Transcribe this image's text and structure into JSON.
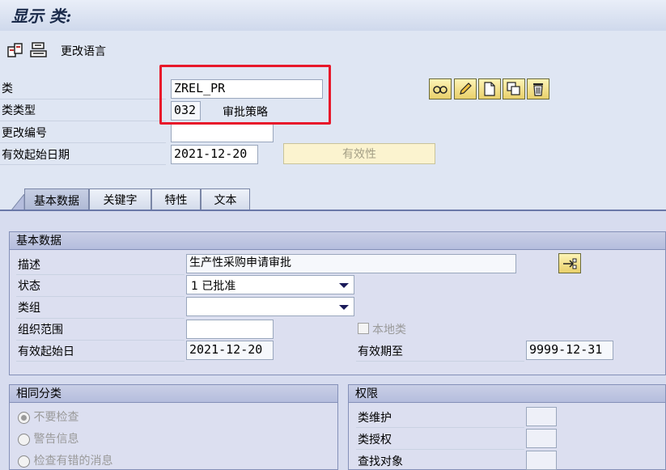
{
  "window": {
    "title": "显示 类:"
  },
  "toolbar": {
    "change_language_label": "更改语言"
  },
  "header": {
    "class_label": "类",
    "class_value": "ZREL_PR",
    "class_type_label": "类类型",
    "class_type_value": "032",
    "class_type_text": "审批策略",
    "change_number_label": "更改编号",
    "change_number_value": "",
    "valid_from_label": "有效起始日期",
    "valid_from_value": "2021-12-20",
    "validity_button": "有效性"
  },
  "tabs": [
    {
      "label": "基本数据",
      "active": true
    },
    {
      "label": "关键字",
      "active": false
    },
    {
      "label": "特性",
      "active": false
    },
    {
      "label": "文本",
      "active": false
    }
  ],
  "basic_data": {
    "title": "基本数据",
    "description_label": "描述",
    "description_value": "生产性采购申请审批",
    "status_label": "状态",
    "status_value": "1 已批准",
    "class_group_label": "类组",
    "class_group_value": "",
    "org_area_label": "组织范围",
    "org_area_value": "",
    "local_class_label": "本地类",
    "valid_from_label": "有效起始日",
    "valid_from_value": "2021-12-20",
    "valid_to_label": "有效期至",
    "valid_to_value": "9999-12-31"
  },
  "same_classification": {
    "title": "相同分类",
    "options": [
      "不要检查",
      "警告信息",
      "检查有错的消息"
    ]
  },
  "authorization": {
    "title": "权限",
    "class_maintenance_label": "类维护",
    "class_authorization_label": "类授权",
    "search_object_label": "查找对象"
  }
}
